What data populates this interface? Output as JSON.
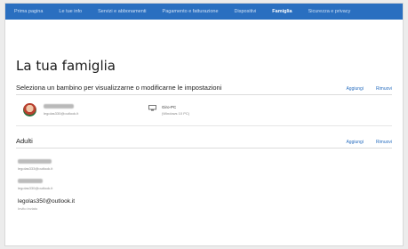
{
  "nav": {
    "items": [
      {
        "label": "Prima pagina",
        "active": false
      },
      {
        "label": "Le tue info",
        "active": false
      },
      {
        "label": "Servizi e abbonamenti",
        "active": false
      },
      {
        "label": "Pagamento e fatturazione",
        "active": false
      },
      {
        "label": "Dispositivi",
        "active": false
      },
      {
        "label": "Famiglia",
        "active": true
      },
      {
        "label": "Sicurezza e privacy",
        "active": false
      }
    ]
  },
  "page": {
    "title": "La tua famiglia"
  },
  "children_section": {
    "title": "Seleziona un bambino per visualizzarne o modificarne le impostazioni",
    "add_label": "Aggiungi",
    "remove_label": "Rimuovi",
    "child": {
      "email": "legolas330@outlook.it",
      "device_name": "Giro-PC",
      "device_os": "(Windows 10 PC)"
    }
  },
  "adults_section": {
    "title": "Adulti",
    "add_label": "Aggiungi",
    "remove_label": "Rimuovi",
    "adults": [
      {
        "email": "legolas333@outlook.it"
      },
      {
        "email": "legolas330@outlook.it"
      },
      {
        "email": "legolas350@outlook.it",
        "status": "Invito inviato"
      }
    ]
  },
  "colors": {
    "accent": "#2a6fc0",
    "background": "#ffffff"
  }
}
